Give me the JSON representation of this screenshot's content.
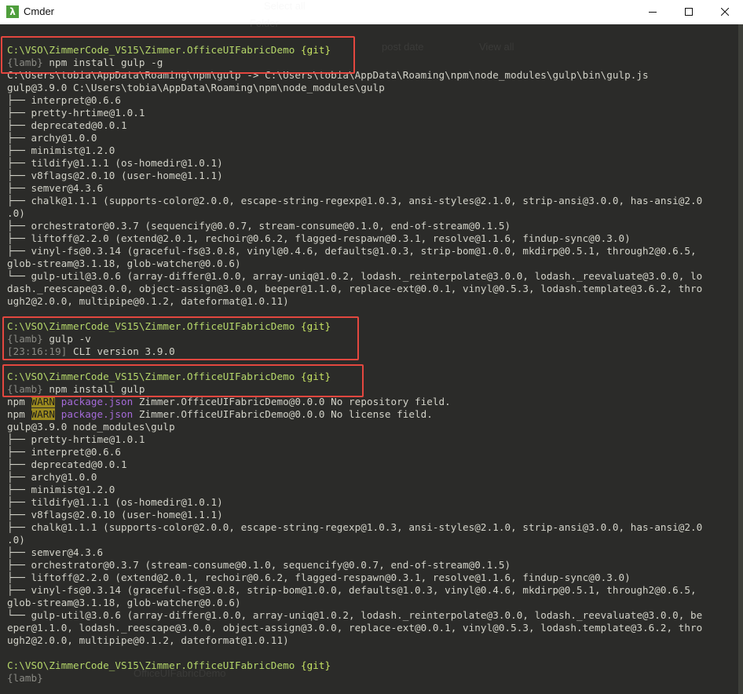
{
  "window": {
    "title": "Cmder",
    "app_icon": "λ"
  },
  "ghost_text": {
    "select_all": "Select all",
    "post_date": "post date",
    "view_all": "View all",
    "folder": "Folder",
    "filename": "OfficeUIFabricDemo"
  },
  "terminal": {
    "lines": [
      {
        "segs": [
          {
            "c": "prompt-path",
            "t": "C:\\VSO\\ZimmerCode_VS15\\Zimmer.OfficeUIFabricDemo "
          },
          {
            "c": "git",
            "t": "{git}"
          }
        ]
      },
      {
        "segs": [
          {
            "c": "lambda",
            "t": "{lamb}"
          },
          {
            "c": "",
            "t": " npm install gulp -g"
          }
        ]
      },
      {
        "segs": [
          {
            "c": "",
            "t": "C:\\Users\\tobia\\AppData\\Roaming\\npm\\gulp -> C:\\Users\\tobia\\AppData\\Roaming\\npm\\node_modules\\gulp\\bin\\gulp.js"
          }
        ]
      },
      {
        "segs": [
          {
            "c": "",
            "t": "gulp@3.9.0 C:\\Users\\tobia\\AppData\\Roaming\\npm\\node_modules\\gulp"
          }
        ]
      },
      {
        "segs": [
          {
            "c": "",
            "t": "├── interpret@0.6.6"
          }
        ]
      },
      {
        "segs": [
          {
            "c": "",
            "t": "├── pretty-hrtime@1.0.1"
          }
        ]
      },
      {
        "segs": [
          {
            "c": "",
            "t": "├── deprecated@0.0.1"
          }
        ]
      },
      {
        "segs": [
          {
            "c": "",
            "t": "├── archy@1.0.0"
          }
        ]
      },
      {
        "segs": [
          {
            "c": "",
            "t": "├── minimist@1.2.0"
          }
        ]
      },
      {
        "segs": [
          {
            "c": "",
            "t": "├── tildify@1.1.1 (os-homedir@1.0.1)"
          }
        ]
      },
      {
        "segs": [
          {
            "c": "",
            "t": "├── v8flags@2.0.10 (user-home@1.1.1)"
          }
        ]
      },
      {
        "segs": [
          {
            "c": "",
            "t": "├── semver@4.3.6"
          }
        ]
      },
      {
        "segs": [
          {
            "c": "",
            "t": "├── chalk@1.1.1 (supports-color@2.0.0, escape-string-regexp@1.0.3, ansi-styles@2.1.0, strip-ansi@3.0.0, has-ansi@2.0"
          }
        ]
      },
      {
        "segs": [
          {
            "c": "",
            "t": ".0)"
          }
        ]
      },
      {
        "segs": [
          {
            "c": "",
            "t": "├── orchestrator@0.3.7 (sequencify@0.0.7, stream-consume@0.1.0, end-of-stream@0.1.5)"
          }
        ]
      },
      {
        "segs": [
          {
            "c": "",
            "t": "├── liftoff@2.2.0 (extend@2.0.1, rechoir@0.6.2, flagged-respawn@0.3.1, resolve@1.1.6, findup-sync@0.3.0)"
          }
        ]
      },
      {
        "segs": [
          {
            "c": "",
            "t": "├── vinyl-fs@0.3.14 (graceful-fs@3.0.8, vinyl@0.4.6, defaults@1.0.3, strip-bom@1.0.0, mkdirp@0.5.1, through2@0.6.5,"
          }
        ]
      },
      {
        "segs": [
          {
            "c": "",
            "t": "glob-stream@3.1.18, glob-watcher@0.0.6)"
          }
        ]
      },
      {
        "segs": [
          {
            "c": "",
            "t": "└── gulp-util@3.0.6 (array-differ@1.0.0, array-uniq@1.0.2, lodash._reinterpolate@3.0.0, lodash._reevaluate@3.0.0, lo"
          }
        ]
      },
      {
        "segs": [
          {
            "c": "",
            "t": "dash._reescape@3.0.0, object-assign@3.0.0, beeper@1.1.0, replace-ext@0.0.1, vinyl@0.5.3, lodash.template@3.6.2, thro"
          }
        ]
      },
      {
        "segs": [
          {
            "c": "",
            "t": "ugh2@2.0.0, multipipe@0.1.2, dateformat@1.0.11)"
          }
        ]
      },
      {
        "segs": [
          {
            "c": "",
            "t": ""
          }
        ]
      },
      {
        "segs": [
          {
            "c": "prompt-path",
            "t": "C:\\VSO\\ZimmerCode_VS15\\Zimmer.OfficeUIFabricDemo "
          },
          {
            "c": "git",
            "t": "{git}"
          }
        ]
      },
      {
        "segs": [
          {
            "c": "lambda",
            "t": "{lamb}"
          },
          {
            "c": "",
            "t": " gulp -v"
          }
        ]
      },
      {
        "segs": [
          {
            "c": "ts",
            "t": "["
          },
          {
            "c": "ts",
            "t": "23:16:19"
          },
          {
            "c": "ts",
            "t": "]"
          },
          {
            "c": "",
            "t": " CLI version 3.9.0"
          }
        ]
      },
      {
        "segs": [
          {
            "c": "",
            "t": ""
          }
        ]
      },
      {
        "segs": [
          {
            "c": "prompt-path",
            "t": "C:\\VSO\\ZimmerCode_VS15\\Zimmer.OfficeUIFabricDemo "
          },
          {
            "c": "git",
            "t": "{git}"
          }
        ]
      },
      {
        "segs": [
          {
            "c": "lambda",
            "t": "{lamb}"
          },
          {
            "c": "",
            "t": " npm install gulp"
          }
        ]
      },
      {
        "segs": [
          {
            "c": "",
            "t": "npm "
          },
          {
            "c": "warn",
            "t": "WARN"
          },
          {
            "c": "",
            "t": " "
          },
          {
            "c": "pkg",
            "t": "package.json"
          },
          {
            "c": "",
            "t": " Zimmer.OfficeUIFabricDemo@0.0.0 No repository field."
          }
        ]
      },
      {
        "segs": [
          {
            "c": "",
            "t": "npm "
          },
          {
            "c": "warn",
            "t": "WARN"
          },
          {
            "c": "",
            "t": " "
          },
          {
            "c": "pkg",
            "t": "package.json"
          },
          {
            "c": "",
            "t": " Zimmer.OfficeUIFabricDemo@0.0.0 No license field."
          }
        ]
      },
      {
        "segs": [
          {
            "c": "",
            "t": "gulp@3.9.0 node_modules\\gulp"
          }
        ]
      },
      {
        "segs": [
          {
            "c": "",
            "t": "├── pretty-hrtime@1.0.1"
          }
        ]
      },
      {
        "segs": [
          {
            "c": "",
            "t": "├── interpret@0.6.6"
          }
        ]
      },
      {
        "segs": [
          {
            "c": "",
            "t": "├── deprecated@0.0.1"
          }
        ]
      },
      {
        "segs": [
          {
            "c": "",
            "t": "├── archy@1.0.0"
          }
        ]
      },
      {
        "segs": [
          {
            "c": "",
            "t": "├── minimist@1.2.0"
          }
        ]
      },
      {
        "segs": [
          {
            "c": "",
            "t": "├── tildify@1.1.1 (os-homedir@1.0.1)"
          }
        ]
      },
      {
        "segs": [
          {
            "c": "",
            "t": "├── v8flags@2.0.10 (user-home@1.1.1)"
          }
        ]
      },
      {
        "segs": [
          {
            "c": "",
            "t": "├── chalk@1.1.1 (supports-color@2.0.0, escape-string-regexp@1.0.3, ansi-styles@2.1.0, strip-ansi@3.0.0, has-ansi@2.0"
          }
        ]
      },
      {
        "segs": [
          {
            "c": "",
            "t": ".0)"
          }
        ]
      },
      {
        "segs": [
          {
            "c": "",
            "t": "├── semver@4.3.6"
          }
        ]
      },
      {
        "segs": [
          {
            "c": "",
            "t": "├── orchestrator@0.3.7 (stream-consume@0.1.0, sequencify@0.0.7, end-of-stream@0.1.5)"
          }
        ]
      },
      {
        "segs": [
          {
            "c": "",
            "t": "├── liftoff@2.2.0 (extend@2.0.1, rechoir@0.6.2, flagged-respawn@0.3.1, resolve@1.1.6, findup-sync@0.3.0)"
          }
        ]
      },
      {
        "segs": [
          {
            "c": "",
            "t": "├── vinyl-fs@0.3.14 (graceful-fs@3.0.8, strip-bom@1.0.0, defaults@1.0.3, vinyl@0.4.6, mkdirp@0.5.1, through2@0.6.5,"
          }
        ]
      },
      {
        "segs": [
          {
            "c": "",
            "t": "glob-stream@3.1.18, glob-watcher@0.0.6)"
          }
        ]
      },
      {
        "segs": [
          {
            "c": "",
            "t": "└── gulp-util@3.0.6 (array-differ@1.0.0, array-uniq@1.0.2, lodash._reinterpolate@3.0.0, lodash._reevaluate@3.0.0, be"
          }
        ]
      },
      {
        "segs": [
          {
            "c": "",
            "t": "eper@1.1.0, lodash._reescape@3.0.0, object-assign@3.0.0, replace-ext@0.0.1, vinyl@0.5.3, lodash.template@3.6.2, thro"
          }
        ]
      },
      {
        "segs": [
          {
            "c": "",
            "t": "ugh2@2.0.0, multipipe@0.1.2, dateformat@1.0.11)"
          }
        ]
      },
      {
        "segs": [
          {
            "c": "",
            "t": ""
          }
        ]
      },
      {
        "segs": [
          {
            "c": "prompt-path",
            "t": "C:\\VSO\\ZimmerCode_VS15\\Zimmer.OfficeUIFabricDemo "
          },
          {
            "c": "git",
            "t": "{git}"
          }
        ]
      },
      {
        "segs": [
          {
            "c": "lambda",
            "t": "{lamb}"
          }
        ]
      }
    ]
  },
  "icons": {
    "minimize": "minimize-icon",
    "maximize": "maximize-icon",
    "close": "close-icon"
  },
  "colors": {
    "highlight_box": "#e3473f",
    "prompt_path": "#b6d86a",
    "git_tag": "#c6e362",
    "warn_bg": "#9c8a1f",
    "package_json": "#a46ad8"
  }
}
